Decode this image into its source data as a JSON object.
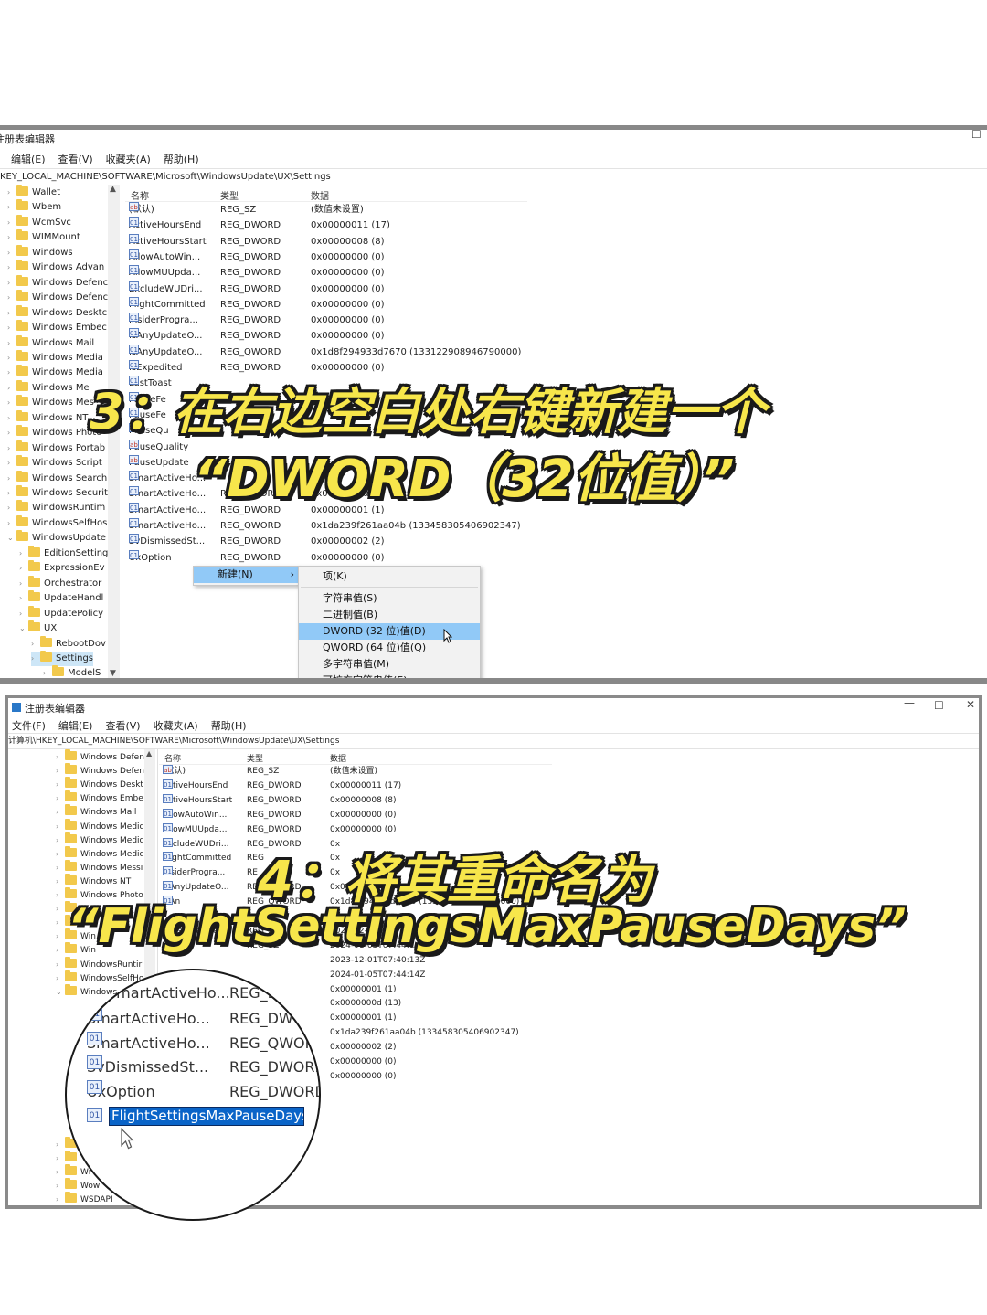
{
  "panel1": {
    "title": "注册表编辑器",
    "menu": [
      "编辑(E)",
      "查看(V)",
      "收藏夹(A)",
      "帮助(H)"
    ],
    "address": "KEY_LOCAL_MACHINE\\SOFTWARE\\Microsoft\\WindowsUpdate\\UX\\Settings",
    "tree": [
      "Wallet",
      "Wbem",
      "WcmSvc",
      "WIMMount",
      "Windows",
      "Windows Advan",
      "Windows Defenc",
      "Windows Defenc",
      "Windows Desktc",
      "Windows Embec",
      "Windows Mail",
      "Windows Media",
      "Windows Media",
      "Windows Me",
      "Windows Mes",
      "Windows NT",
      "Windows Photo",
      "Windows Portab",
      "Windows Script",
      "Windows Search",
      "Windows Securit",
      "WindowsRuntim",
      "WindowsSelfHos",
      "WindowsUpdate",
      "EditionSetting",
      "ExpressionEv",
      "Orchestrator",
      "UpdateHandl",
      "UpdatePolicy",
      "UX",
      "RebootDov",
      "Settings",
      "ModelS"
    ],
    "columns": {
      "name": "名称",
      "type": "类型",
      "data": "数据"
    },
    "rows": [
      {
        "name": "(默认)",
        "type": "REG_SZ",
        "data": "(数值未设置)",
        "icon": "ab"
      },
      {
        "name": "ActiveHoursEnd",
        "type": "REG_DWORD",
        "data": "0x00000011 (17)",
        "icon": "bin"
      },
      {
        "name": "ActiveHoursStart",
        "type": "REG_DWORD",
        "data": "0x00000008 (8)",
        "icon": "bin"
      },
      {
        "name": "AllowAutoWin...",
        "type": "REG_DWORD",
        "data": "0x00000000 (0)",
        "icon": "bin"
      },
      {
        "name": "AllowMUUpda...",
        "type": "REG_DWORD",
        "data": "0x00000000 (0)",
        "icon": "bin"
      },
      {
        "name": "ExcludeWUDri...",
        "type": "REG_DWORD",
        "data": "0x00000000 (0)",
        "icon": "bin"
      },
      {
        "name": "FlightCommitted",
        "type": "REG_DWORD",
        "data": "0x00000000 (0)",
        "icon": "bin"
      },
      {
        "name": "InsiderProgra...",
        "type": "REG_DWORD",
        "data": "0x00000000 (0)",
        "icon": "bin"
      },
      {
        "name": "IsAnyUpdateO...",
        "type": "REG_DWORD",
        "data": "0x00000000 (0)",
        "icon": "bin"
      },
      {
        "name": "IsAnyUpdateO...",
        "type": "REG_QWORD",
        "data": "0x1d8f294933d7670 (133122908946790000)",
        "icon": "bin"
      },
      {
        "name": "IsExpedited",
        "type": "REG_DWORD",
        "data": "0x00000000 (0)",
        "icon": "bin"
      },
      {
        "name": "LastToast",
        "type": "",
        "data": "",
        "icon": "bin"
      },
      {
        "name": "PauseFe",
        "type": "",
        "data": "",
        "icon": "bin"
      },
      {
        "name": "PauseFe",
        "type": "",
        "data": "",
        "icon": "bin"
      },
      {
        "name": "PauseQu",
        "type": "",
        "data": "",
        "icon": "ab"
      },
      {
        "name": "PauseQuality",
        "type": "",
        "data": "",
        "icon": "ab"
      },
      {
        "name": "PauseUpdate",
        "type": "",
        "data": "",
        "icon": "ab"
      },
      {
        "name": "SmartActiveHo...",
        "type": "",
        "data": "",
        "icon": "bin"
      },
      {
        "name": "SmartActiveHo...",
        "type": "REG_DWORD",
        "data": "0x00000000 (0)",
        "icon": "bin"
      },
      {
        "name": "SmartActiveHo...",
        "type": "REG_DWORD",
        "data": "0x00000001 (1)",
        "icon": "bin"
      },
      {
        "name": "SmartActiveHo...",
        "type": "REG_QWORD",
        "data": "0x1da239f261aa04b (133458305406902347)",
        "icon": "bin"
      },
      {
        "name": "SvDismissedSt...",
        "type": "REG_DWORD",
        "data": "0x00000002 (2)",
        "icon": "bin"
      },
      {
        "name": "UxOption",
        "type": "REG_DWORD",
        "data": "0x00000000 (0)",
        "icon": "bin"
      }
    ],
    "context_menu": {
      "new_label": "新建(N)",
      "arrow": "›"
    },
    "submenu": [
      "项(K)",
      "字符串值(S)",
      "二进制值(B)",
      "DWORD (32 位)值(D)",
      "QWORD (64 位)值(Q)",
      "多字符串值(M)",
      "可扩充字符串值(E)"
    ],
    "caption_line1": "3：在右边空白处右键新建一个",
    "caption_line2": "“DWORD（32位值）”"
  },
  "panel2": {
    "title": "注册表编辑器",
    "menu": [
      "文件(F)",
      "编辑(E)",
      "查看(V)",
      "收藏夹(A)",
      "帮助(H)"
    ],
    "address": "计算机\\HKEY_LOCAL_MACHINE\\SOFTWARE\\Microsoft\\WindowsUpdate\\UX\\Settings",
    "tree": [
      "Windows Defen",
      "Windows Defen",
      "Windows Deskt",
      "Windows Embe",
      "Windows Mail",
      "Windows Medic",
      "Windows Medic",
      "Windows Medic",
      "Windows Messi",
      "Windows NT",
      "Windows Photo",
      "",
      "",
      "Win",
      "Win",
      "WindowsRuntir",
      "WindowsSelfHo",
      "Windows"
    ],
    "tree_bottom": [
      "",
      "",
      "Wi",
      "Wow",
      "WSDAPI"
    ],
    "columns": {
      "name": "名称",
      "type": "类型",
      "data": "数据"
    },
    "rows": [
      {
        "name": "(默认)",
        "type": "REG_SZ",
        "data": "(数值未设置)",
        "icon": "ab"
      },
      {
        "name": "ActiveHoursEnd",
        "type": "REG_DWORD",
        "data": "0x00000011 (17)",
        "icon": "bin"
      },
      {
        "name": "ActiveHoursStart",
        "type": "REG_DWORD",
        "data": "0x00000008 (8)",
        "icon": "bin"
      },
      {
        "name": "AllowAutoWin...",
        "type": "REG_DWORD",
        "data": "0x00000000 (0)",
        "icon": "bin"
      },
      {
        "name": "AllowMUUpda...",
        "type": "REG_DWORD",
        "data": "0x00000000 (0)",
        "icon": "bin"
      },
      {
        "name": "ExcludeWUDri...",
        "type": "REG_DWORD",
        "data": "0x",
        "icon": "bin"
      },
      {
        "name": "FlightCommitted",
        "type": "REG",
        "data": "0x",
        "icon": "bin"
      },
      {
        "name": "InsiderProgra...",
        "type": "RE",
        "data": "0x",
        "icon": "bin"
      },
      {
        "name": "IsAnyUpdateO...",
        "type": "REG_DWORD",
        "data": "0x00",
        "icon": "bin"
      },
      {
        "name": "IsAn",
        "type": "REG_QWORD",
        "data": "0x1d8f294933d7670 (133122908946790000)",
        "icon": "bin"
      },
      {
        "name": "",
        "type": "",
        "data": "",
        "icon": ""
      },
      {
        "name": "PauseFeatureU...",
        "type": "REG_SZ",
        "data": "2023-12-01T07:",
        "icon": "ab"
      },
      {
        "name": "",
        "type": "REG_SZ",
        "data": "2024-01-05T07:44:14Z",
        "icon": ""
      },
      {
        "name": "",
        "type": "",
        "data": "2023-12-01T07:40:13Z",
        "icon": ""
      },
      {
        "name": "",
        "type": "",
        "data": "2024-01-05T07:44:14Z",
        "icon": ""
      },
      {
        "name": "",
        "type": "",
        "data": "0x00000001 (1)",
        "icon": ""
      },
      {
        "name": "",
        "type": "",
        "data": "0x0000000d (13)",
        "icon": ""
      },
      {
        "name": "",
        "type": "",
        "data": "0x00000001 (1)",
        "icon": ""
      },
      {
        "name": "",
        "type": "",
        "data": "0x1da239f261aa04b (133458305406902347)",
        "icon": ""
      },
      {
        "name": "",
        "type": "",
        "data": "0x00000002 (2)",
        "icon": ""
      },
      {
        "name": "",
        "type": "",
        "data": "0x00000000 (0)",
        "icon": ""
      },
      {
        "name": "",
        "type": "",
        "data": "0x00000000 (0)",
        "icon": ""
      }
    ],
    "magnifier": [
      {
        "name": "SmartActiveHo...",
        "type": "REG_DWO"
      },
      {
        "name": "SmartActiveHo...",
        "type": "REG_QWOR"
      },
      {
        "name": "SvDismissedSt...",
        "type": "REG_DWORD"
      },
      {
        "name": "UxOption",
        "type": "REG_DWORD"
      }
    ],
    "magnifier_top": {
      "name": "SmartActiveHo...",
      "type": "REG_D"
    },
    "rename_value": "FlightSettingsMaxPauseDays",
    "caption_line1": "4：将其重命名为",
    "caption_line2": "“FlightSettingsMaxPauseDays”"
  },
  "colors": {
    "caption": "#f7e64b",
    "highlight": "#91c9f7",
    "rename": "#0a64c8"
  }
}
